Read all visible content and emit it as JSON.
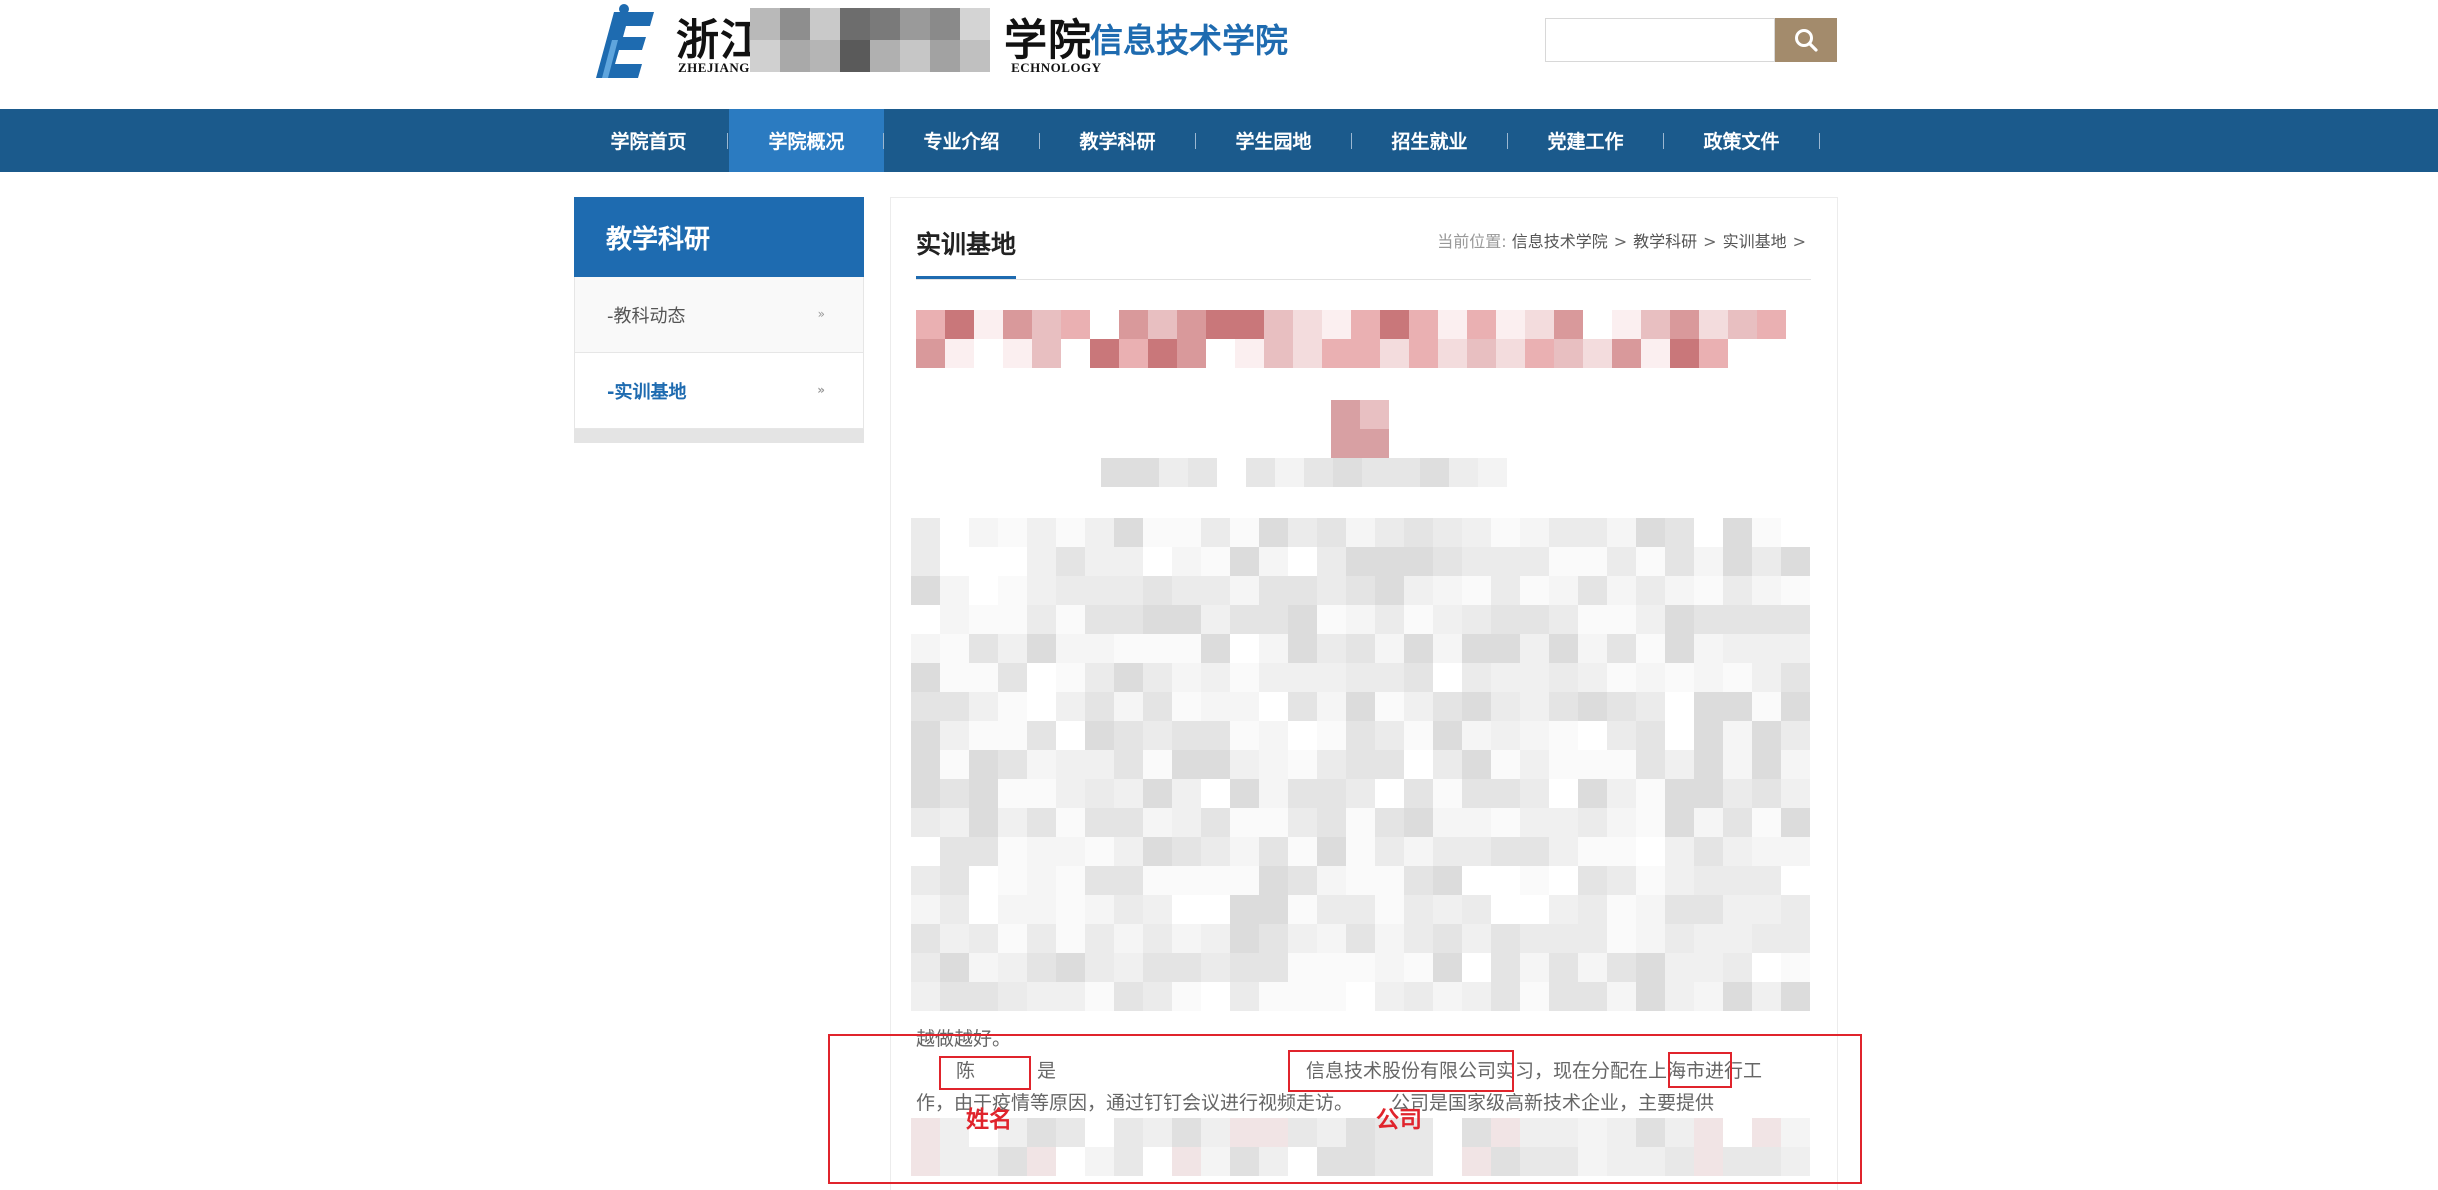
{
  "header": {
    "logo_name_visible_left": "浙江",
    "logo_name_visible_right": "学院",
    "logo_english_left": "ZHEJIANG Y",
    "logo_english_right": "ECHNOLOGY",
    "department": "信息技术学院",
    "search_placeholder": ""
  },
  "nav": {
    "items": [
      {
        "label": "学院首页"
      },
      {
        "label": "学院概况"
      },
      {
        "label": "专业介绍"
      },
      {
        "label": "教学科研"
      },
      {
        "label": "学生园地"
      },
      {
        "label": "招生就业"
      },
      {
        "label": "党建工作"
      },
      {
        "label": "政策文件"
      }
    ],
    "active_index": 1
  },
  "sidebar": {
    "title": "教学科研",
    "items": [
      {
        "label": "-教科动态",
        "arrow": "»"
      },
      {
        "label": "-实训基地",
        "arrow": "»"
      }
    ],
    "active_index": 1
  },
  "content": {
    "title": "实训基地",
    "breadcrumb": {
      "prefix": "当前位置:",
      "items": [
        "信息技术学院",
        "教学科研",
        "实训基地"
      ],
      "separator": ">"
    },
    "line_fragment": "越做越好。",
    "para_line1_a": "陈",
    "para_line1_b": "是",
    "para_line1_c": "信息技术股份有限公司实习，现在分配在上海市进行工",
    "para_line2_a": "作，由于疫情等原因，通过钉钉会议进行视频走访。",
    "para_line2_b": "公司是国家级高新技术企业，主要提供"
  },
  "annotations": {
    "name_label": "姓名",
    "company_label": "公司",
    "color": "#e0242c"
  },
  "colors": {
    "nav_bg": "#1b5a8c",
    "nav_active": "#2b7bc1",
    "brand_blue": "#1e6bb0",
    "search_button": "#a38b6c"
  }
}
